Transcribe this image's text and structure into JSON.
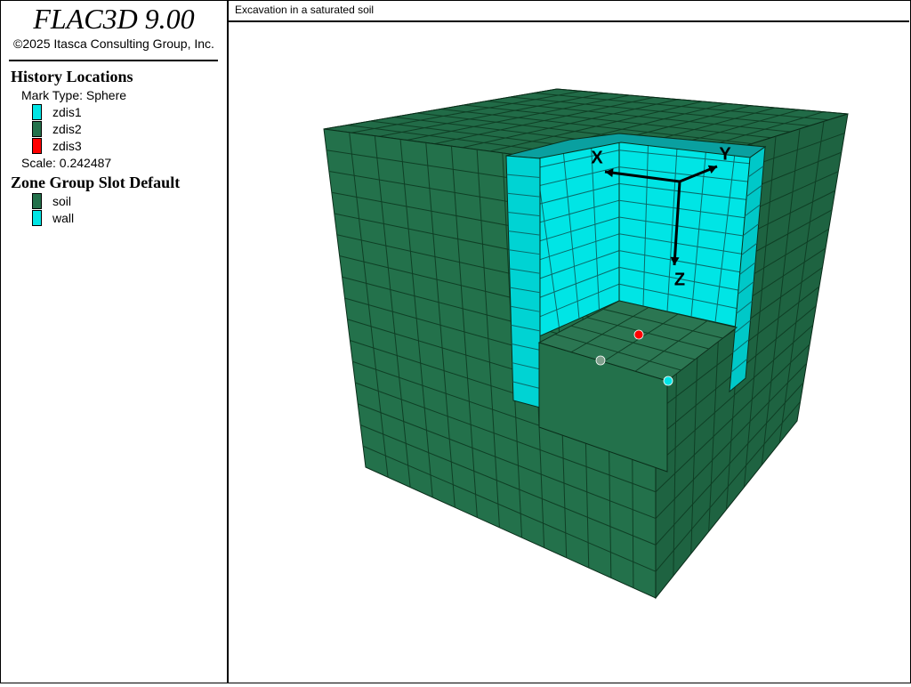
{
  "app": {
    "title": "FLAC3D 9.00",
    "copyright": "©2025 Itasca Consulting Group, Inc."
  },
  "legend": {
    "history": {
      "title": "History Locations",
      "mark_type": "Mark Type: Sphere",
      "items": [
        {
          "label": "zdis1",
          "color": "#00e5e5"
        },
        {
          "label": "zdis2",
          "color": "#23714b"
        },
        {
          "label": "zdis3",
          "color": "#ff0000"
        }
      ],
      "scale": "Scale: 0.242487"
    },
    "zone_group": {
      "title": "Zone Group Slot Default",
      "items": [
        {
          "label": "soil",
          "color": "#23714b"
        },
        {
          "label": "wall",
          "color": "#00e5e5"
        }
      ]
    }
  },
  "view": {
    "title": "Excavation in a saturated soil",
    "axes": {
      "x": "X",
      "y": "Y",
      "z": "Z"
    },
    "model": {
      "soil_color": "#23714b",
      "wall_color": "#00e5e5",
      "history_markers": [
        {
          "name": "zdis1",
          "color": "#00e5e5"
        },
        {
          "name": "zdis2",
          "color": "#23714b"
        },
        {
          "name": "zdis3",
          "color": "#ff0000"
        }
      ]
    }
  }
}
